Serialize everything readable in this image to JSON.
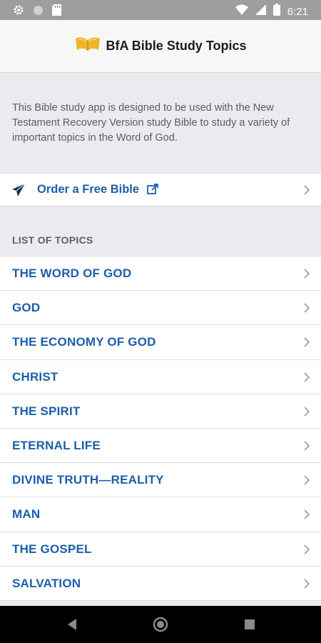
{
  "status_bar": {
    "time": "6:21",
    "icons": [
      "settings-icon",
      "circle-icon",
      "sd-card-icon",
      "wifi-icon",
      "signal-icon",
      "battery-icon"
    ]
  },
  "header": {
    "title": "BfA Bible Study Topics",
    "logo": "open-bible-icon"
  },
  "intro": {
    "text": "This Bible study app is designed to be used with the New Testament Recovery Version study Bible to study a variety of important topics in the Word of God."
  },
  "order": {
    "label": "Order a Free Bible",
    "icon": "paper-plane-icon",
    "external_icon": "external-link-icon"
  },
  "topics_section": {
    "heading": "LIST OF TOPICS",
    "items": [
      {
        "label": "THE WORD OF GOD"
      },
      {
        "label": "GOD"
      },
      {
        "label": "THE ECONOMY OF GOD"
      },
      {
        "label": "CHRIST"
      },
      {
        "label": "THE SPIRIT"
      },
      {
        "label": "ETERNAL LIFE"
      },
      {
        "label": "DIVINE TRUTH—REALITY"
      },
      {
        "label": "MAN"
      },
      {
        "label": "THE GOSPEL"
      },
      {
        "label": "SALVATION"
      }
    ]
  },
  "colors": {
    "accent": "#1d5ea9",
    "statusbar": "#9e9e9e",
    "background": "#ebebef",
    "logo_gold": "#f0b429"
  },
  "nav_bar": {
    "icons": [
      "back-icon",
      "home-icon",
      "recents-icon"
    ]
  }
}
